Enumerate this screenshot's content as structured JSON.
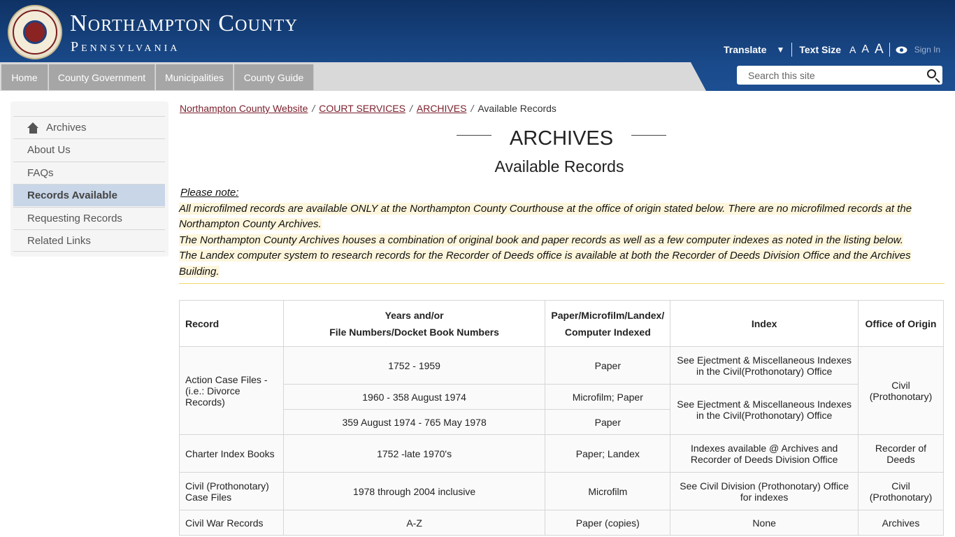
{
  "header": {
    "title": "Northampton County",
    "subtitle": "Pennsylvania",
    "translate_label": "Translate",
    "translate_arrow": "▼",
    "text_size_label": "Text Size",
    "size_small": "A",
    "size_medium": "A",
    "size_large": "A",
    "sign_in": "Sign In"
  },
  "nav": {
    "items": [
      "Home",
      "County Government",
      "Municipalities",
      "County Guide"
    ]
  },
  "search": {
    "placeholder": "Search this site"
  },
  "sidebar": {
    "items": [
      {
        "label": "Archives"
      },
      {
        "label": "About Us"
      },
      {
        "label": "FAQs"
      },
      {
        "label": "Records Available"
      },
      {
        "label": "Requesting Records"
      },
      {
        "label": "Related Links"
      }
    ]
  },
  "breadcrumb": {
    "items": [
      "Northampton County Website",
      "COURT SERVICES",
      "ARCHIVES",
      "Available Records"
    ],
    "separator": "/"
  },
  "page": {
    "title": "ARCHIVES",
    "subtitle": "Available Records"
  },
  "note": {
    "title": "Please note:",
    "line1": "All microfilmed records are available ONLY at the Northampton County Courthouse at the office of origin stated below.  There are no microfilmed records at the",
    "line2": "Northampton County Archives.",
    "line3": "The Northampton County Archives houses a combination of original book and paper records as well as a few computer indexes as noted in the listing below.",
    "line4": "The Landex computer system to research records for the Recorder of Deeds office is available at both the Recorder of Deeds Division Office and the Archives Building."
  },
  "table": {
    "headers": {
      "record": "Record",
      "years_1": "Years and/or",
      "years_2": "File Numbers/Docket Book Numbers",
      "format_1": "Paper/Microfilm/Landex/",
      "format_2": "Computer Indexed",
      "index": "Index",
      "office": "Office of Origin"
    },
    "action": {
      "record": "Action Case Files - (i.e.: Divorce Records)",
      "years": [
        "1752 - 1959",
        "1960 - 358 August 1974",
        "359 August 1974 - 765 May 1978"
      ],
      "format": [
        "Paper",
        "Microfilm; Paper",
        "Paper"
      ],
      "index_1": "See Ejectment & Miscellaneous Indexes in the Civil(Prothonotary) Office",
      "index_2": "See Ejectment & Miscellaneous Indexes in the Civil(Prothonotary) Office",
      "office": "Civil (Prothonotary)"
    },
    "rows": [
      {
        "record": "Charter Index Books",
        "years": "1752 -late 1970's",
        "format": "Paper; Landex",
        "index": "Indexes available @ Archives and Recorder of Deeds Division Office",
        "office": "Recorder of Deeds"
      },
      {
        "record": "Civil (Prothonotary) Case Files",
        "years": "1978 through 2004 inclusive",
        "format": "Microfilm",
        "index": "See Civil Division (Prothonotary) Office for indexes",
        "office": "Civil (Prothonotary)"
      },
      {
        "record": "Civil War Records",
        "years": "A-Z",
        "format": "Paper (copies)",
        "index": "None",
        "office": "Archives"
      }
    ]
  }
}
